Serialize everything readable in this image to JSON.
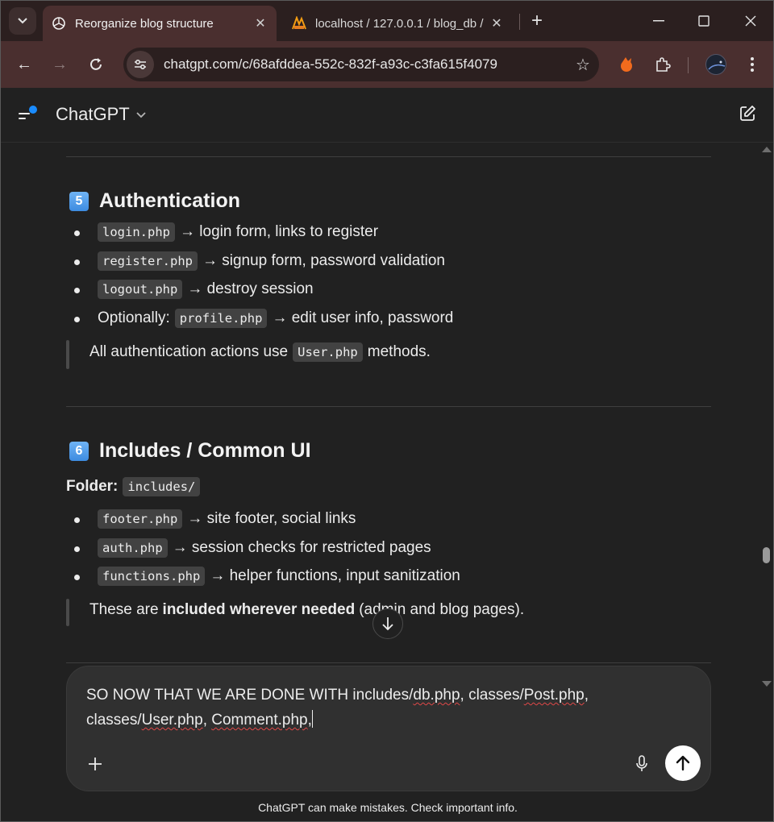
{
  "browser": {
    "tabs": [
      {
        "title": "Reorganize blog structure",
        "active": true
      },
      {
        "title": "localhost / 127.0.0.1 / blog_db /",
        "active": false
      }
    ],
    "url": "chatgpt.com/c/68afddea-552c-832f-a93c-c3fa615f4079",
    "theme_color": "#4a2f2f"
  },
  "header": {
    "title": "ChatGPT"
  },
  "sections": {
    "auth": {
      "number": "5",
      "title": "Authentication",
      "items": [
        {
          "code": "login.php",
          "text": "→ login form, links to register"
        },
        {
          "code": "register.php",
          "text": "→ signup form, password validation"
        },
        {
          "code": "logout.php",
          "text": "→ destroy session"
        },
        {
          "prefix": "Optionally:",
          "code": "profile.php",
          "text": "→ edit user info, password"
        }
      ],
      "note": {
        "before": "All authentication actions use",
        "code": "User.php",
        "after": "methods."
      }
    },
    "includes": {
      "number": "6",
      "title": "Includes / Common UI",
      "folder_label": "Folder:",
      "folder_code": "includes/",
      "items": [
        {
          "code": "footer.php",
          "text": "→ site footer, social links"
        },
        {
          "code": "auth.php",
          "text": "→ session checks for restricted pages"
        },
        {
          "code": "functions.php",
          "text": "→ helper functions, input sanitization"
        }
      ],
      "note": {
        "before": "These are",
        "bold": "included wherever needed",
        "after": "(admin and blog pages)."
      }
    }
  },
  "composer": {
    "line1_a": "SO NOW THAT WE ARE DONE WITH includes/",
    "line1_b": "db.php",
    "line1_c": ", classes/",
    "line1_d": "Post.php",
    "line1_e": ",",
    "line2_a": "classes/",
    "line2_b": "User.php",
    "line2_c": ", ",
    "line2_d": "Comment.php",
    "line2_e": ","
  },
  "footer": {
    "disclaimer": "ChatGPT can make mistakes. Check important info."
  }
}
